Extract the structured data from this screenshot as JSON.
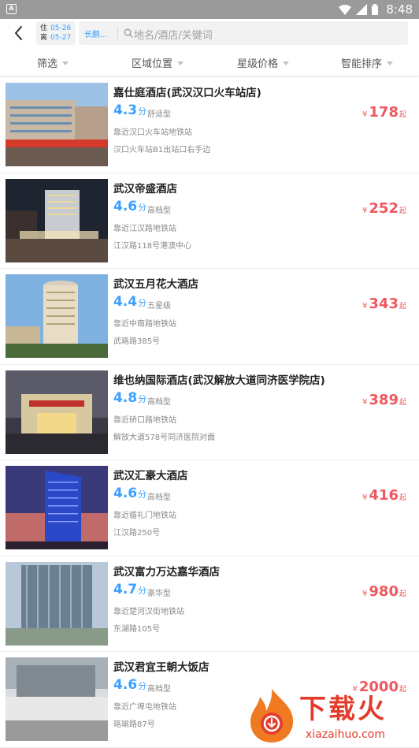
{
  "status_bar": {
    "time": "8:48",
    "app_icon_letter": "A"
  },
  "header": {
    "checkin_label": "住",
    "checkin_date": "05-26",
    "checkout_label": "离",
    "checkout_date": "05-27",
    "city": "长鹏...",
    "search_placeholder": "地名/酒店/关键词"
  },
  "filters": [
    {
      "label": "筛选"
    },
    {
      "label": "区域位置"
    },
    {
      "label": "星级价格"
    },
    {
      "label": "智能排序"
    }
  ],
  "currency_symbol": "¥",
  "price_suffix": "起",
  "score_unit": "分",
  "hotels": [
    {
      "name": "嘉仕庭酒店(武汉汉口火车站店)",
      "score": "4.3",
      "grade": "舒适型",
      "metro": "靠近汉口火车站地铁站",
      "address": "汉口火车站B1出站口右手边",
      "price": "178"
    },
    {
      "name": "武汉帝盛酒店",
      "score": "4.6",
      "grade": "高档型",
      "metro": "靠近江汉路地铁站",
      "address": "江汉路118号港澳中心",
      "price": "252"
    },
    {
      "name": "武汉五月花大酒店",
      "score": "4.4",
      "grade": "五星级",
      "metro": "靠近中南路地铁站",
      "address": "武珞路385号",
      "price": "343"
    },
    {
      "name": "维也纳国际酒店(武汉解放大道同济医学院店)",
      "score": "4.8",
      "grade": "高档型",
      "metro": "靠近硚口路地铁站",
      "address": "解放大道578号同济医院对面",
      "price": "389"
    },
    {
      "name": "武汉汇豪大酒店",
      "score": "4.6",
      "grade": "高档型",
      "metro": "靠近循礼门地铁站",
      "address": "江汉路250号",
      "price": "416"
    },
    {
      "name": "武汉富力万达嘉华酒店",
      "score": "4.7",
      "grade": "豪华型",
      "metro": "靠近楚河汉街地铁站",
      "address": "东湖路105号",
      "price": "980"
    },
    {
      "name": "武汉君宜王朝大饭店",
      "score": "4.6",
      "grade": "高档型",
      "metro": "靠近广埠屯地铁站",
      "address": "珞瑜路87号",
      "price": "2000"
    }
  ],
  "watermark": {
    "text": "下载火",
    "url": "xiazaihuo.com"
  },
  "colors": {
    "accent_blue": "#3aa0ff",
    "price_red": "#f0585f",
    "status_bar": "#9a9a9a"
  }
}
